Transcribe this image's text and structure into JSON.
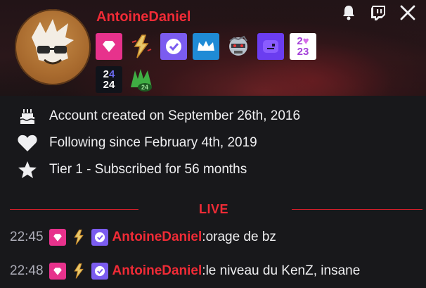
{
  "user": {
    "name": "AntoineDaniel"
  },
  "top_icons": [
    "bell-icon",
    "twitch-icon",
    "close-icon"
  ],
  "badges": [
    "prime-gaming-badge",
    "lightning-badge",
    "verified-badge",
    "crown-badge",
    "robot-skull-badge",
    "purple-blob-badge",
    "2023-badge",
    "2024-badge",
    "green-wings-badge"
  ],
  "info": {
    "created": "Account created on September 26th, 2016",
    "following": "Following since February 4th, 2019",
    "subscribed": "Tier 1 - Subscribed for 56 months"
  },
  "live": {
    "label": "LIVE"
  },
  "messages": [
    {
      "time": "22:45",
      "author": "AntoineDaniel",
      "sep": ":",
      "text": " orage de bz"
    },
    {
      "time": "22:48",
      "author": "AntoineDaniel",
      "sep": ":",
      "text": " le niveau du KenZ, insane"
    }
  ],
  "badge_year_2023": {
    "top": "2",
    "heart": "♥",
    "bottom": "23"
  },
  "badge_year_2024": {
    "top": "2",
    "dot": "4",
    "bottom": "24"
  },
  "badge_wings_label": "24",
  "colors": {
    "username": "#f02b36",
    "background": "#18181b",
    "prime": "#e7328c",
    "verified": "#7b5cf0",
    "crown": "#1f8bd6"
  }
}
